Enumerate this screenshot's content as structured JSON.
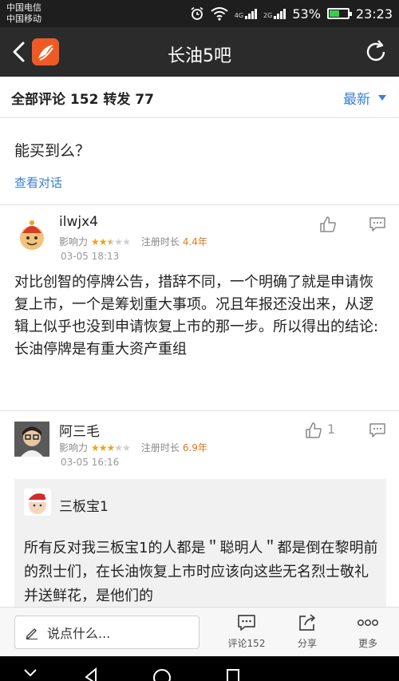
{
  "status_bar": {
    "carrier_1": "中国电信",
    "carrier_2": "中国移动",
    "net_1": "4G",
    "net_2": "2G",
    "battery": "53%",
    "battery_level": 0.53,
    "time": "23:23"
  },
  "header": {
    "title": "长油5吧"
  },
  "tabs": {
    "summary": "全部评论 152  转发 77",
    "sort_label": "最新"
  },
  "previous_post": {
    "text": "能买到么？",
    "view_conversation": "查看对话"
  },
  "posts": [
    {
      "username": "ilwjx4",
      "influence_label": "影响力",
      "rating": 2.5,
      "reg_label": "注册时长",
      "reg_age": "4.4年",
      "time": "03-05 18:13",
      "likes": "",
      "text": "对比创智的停牌公告，措辞不同，一个明确了就是申请恢复上市，一个是筹划重大事项。况且年报还没出来，从逻辑上似乎也没到申请恢复上市的那一步。所以得出的结论:长油停牌是有重大资产重组"
    },
    {
      "username": "阿三毛",
      "influence_label": "影响力",
      "rating": 3,
      "reg_label": "注册时长",
      "reg_age": "6.9年",
      "time": "03-05 16:16",
      "likes": "1",
      "quote": {
        "username": "三板宝1",
        "text": "所有反对我三板宝1的人都是＂聪明人＂都是倒在黎明前的烈士们，在长油恢复上市时应该向这些无名烈士敬礼并送鲜花，是他们的"
      }
    }
  ],
  "bottom_bar": {
    "comment_placeholder": "说点什么...",
    "comment_action": "评论152",
    "share_action": "分享",
    "more_action": "更多"
  },
  "colors": {
    "accent": "#3b7fd4",
    "star": "#f0a020",
    "age": "#e07b1a",
    "logo": "#ef5a24"
  }
}
